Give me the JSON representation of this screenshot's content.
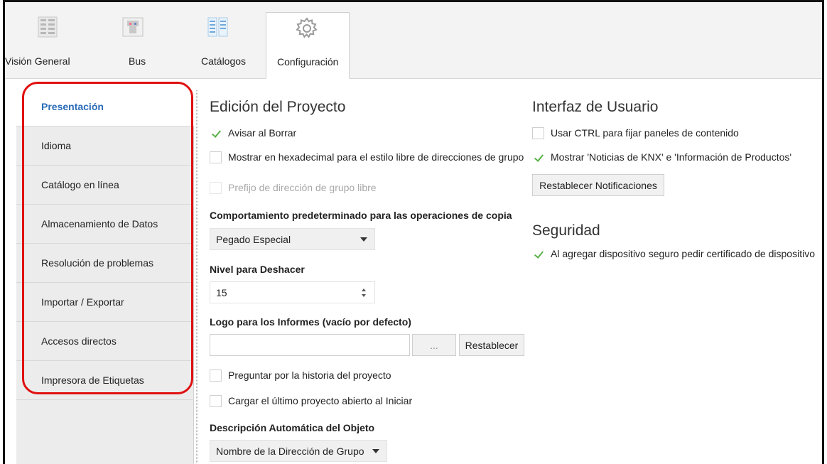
{
  "ribbon": {
    "tabs": [
      {
        "label": "Visión General",
        "icon": "overview-icon"
      },
      {
        "label": "Bus",
        "icon": "bus-icon"
      },
      {
        "label": "Catálogos",
        "icon": "catalogs-icon"
      },
      {
        "label": "Configuración",
        "icon": "gear-icon",
        "active": true
      }
    ]
  },
  "sidebar": {
    "items": [
      {
        "label": "Presentación",
        "active": true
      },
      {
        "label": "Idioma"
      },
      {
        "label": "Catálogo en línea"
      },
      {
        "label": "Almacenamiento de Datos"
      },
      {
        "label": "Resolución de problemas"
      },
      {
        "label": "Importar / Exportar"
      },
      {
        "label": "Accesos directos"
      },
      {
        "label": "Impresora de Etiquetas"
      }
    ],
    "highlight_color": "#e01010"
  },
  "project": {
    "title": "Edición del Proyecto",
    "warn_delete": "Avisar al Borrar",
    "hex_display": "Mostrar en hexadecimal para el estilo libre de direcciones de grupo",
    "free_prefix": "Prefijo de dirección de grupo libre",
    "copy_label": "Comportamiento predeterminado para las operaciones de copia",
    "copy_value": "Pegado Especial",
    "undo_label": "Nivel para Deshacer",
    "undo_value": "15",
    "logo_label": "Logo para los Informes (vacío por defecto)",
    "browse_button": "...",
    "reset_button": "Restablecer",
    "ask_history": "Preguntar por la historia del proyecto",
    "load_last": "Cargar el último proyecto abierto al Iniciar",
    "auto_desc_label": "Descripción Automática del Objeto",
    "auto_desc_value": "Nombre de la Dirección de Grupo"
  },
  "ui": {
    "title": "Interfaz de Usuario",
    "ctrl_pin": "Usar CTRL para fijar paneles de contenido",
    "show_news": "Mostrar 'Noticias de KNX' e 'Información de Productos'",
    "reset_notifications": "Restablecer Notificaciones"
  },
  "security": {
    "title": "Seguridad",
    "ask_certificate": "Al agregar dispositivo seguro pedir certificado de dispositivo"
  },
  "colors": {
    "accent": "#2a6bb8",
    "check": "#5ab04a"
  }
}
